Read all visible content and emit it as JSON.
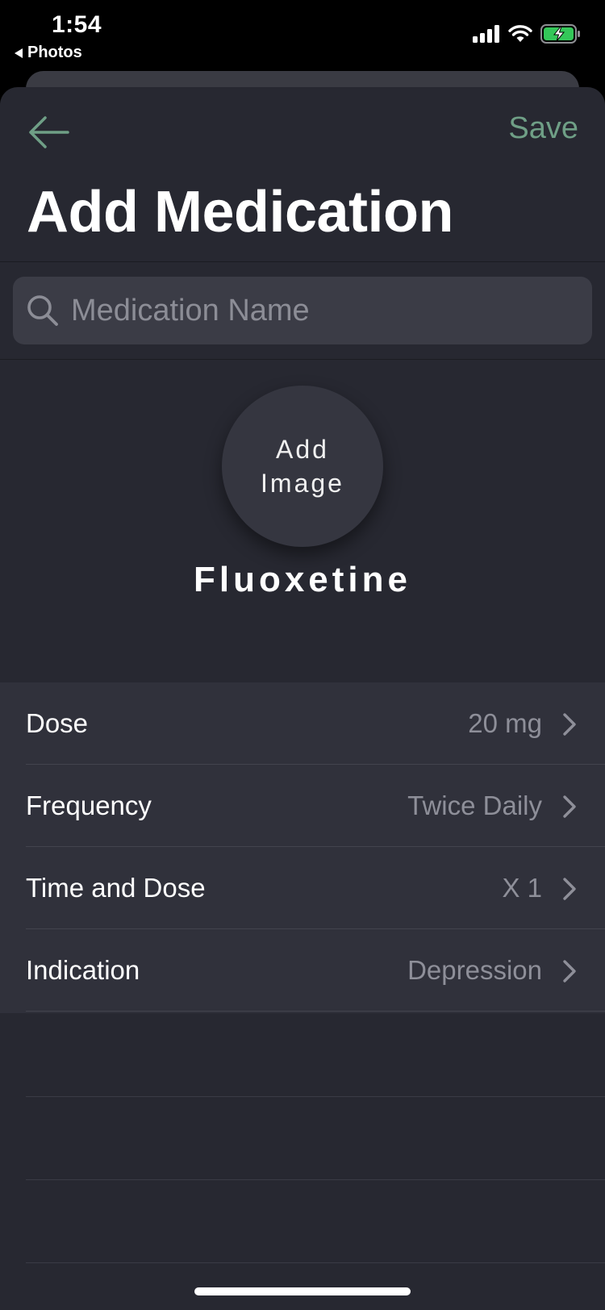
{
  "status_bar": {
    "time": "1:54",
    "back_app": "Photos"
  },
  "nav": {
    "save_label": "Save",
    "accent_color": "#6f9f86"
  },
  "page": {
    "title": "Add Medication"
  },
  "search": {
    "placeholder": "Medication Name",
    "value": ""
  },
  "image_button": {
    "line1": "Add",
    "line2": "Image"
  },
  "medication": {
    "name": "Fluoxetine"
  },
  "rows": [
    {
      "label": "Dose",
      "value": "20 mg"
    },
    {
      "label": "Frequency",
      "value": "Twice Daily"
    },
    {
      "label": "Time and Dose",
      "value": "X 1"
    },
    {
      "label": "Indication",
      "value": "Depression"
    }
  ],
  "icons": {
    "back": "arrow-left-icon",
    "search": "magnifier-icon",
    "chevron": "chevron-right-icon",
    "signal": "cellular-signal-icon",
    "wifi": "wifi-icon",
    "battery": "battery-charging-icon"
  }
}
